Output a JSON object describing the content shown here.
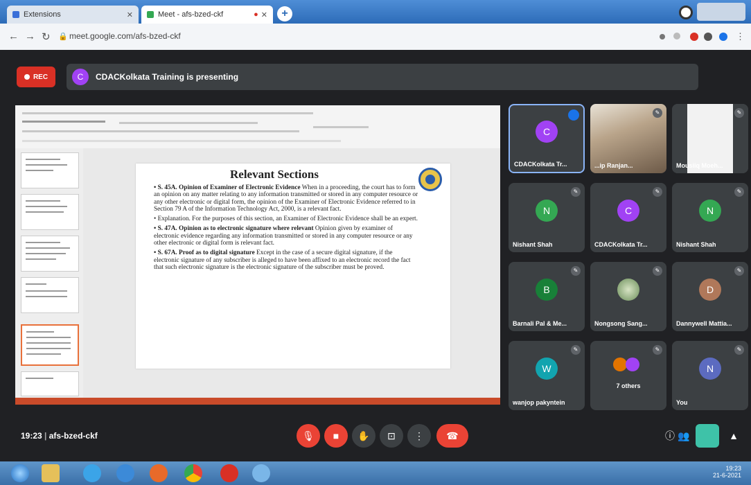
{
  "browser": {
    "tabs": [
      {
        "label": "Extensions"
      },
      {
        "label": "Meet - afs-bzed-ckf"
      }
    ],
    "new_tab": "+",
    "url": "meet.google.com/afs-bzed-ckf"
  },
  "meet": {
    "rec_label": "REC",
    "presenter_avatar": "C",
    "presenting_text": "CDACKolkata Training is presenting",
    "meeting_time": "19:23",
    "meeting_code": "afs-bzed-ckf"
  },
  "slide": {
    "title": "Relevant Sections",
    "bullets": [
      {
        "bold": "• S. 45A. Opinion of Examiner of Electronic Evidence",
        "text": " When in a proceeding, the court has to form an opinion on any matter relating to any information transmitted or stored in any computer resource or any other electronic or digital form, the opinion of the Examiner of Electronic Evidence referred to in Section 79 A of the Information Technology Act, 2000, is a relevant fact."
      },
      {
        "bold": "",
        "text": "• Explanation. For the purposes of this section, an Examiner of Electronic Evidence shall be an expert."
      },
      {
        "bold": "• S. 47A. Opinion as to electronic signature where relevant",
        "text": " Opinion given by examiner of electronic evidence regarding any information transmitted or stored in any computer resource or any other electronic or digital form is relevant fact."
      },
      {
        "bold": "• S. 67A. Proof as to digital signature",
        "text": " Except in the case of a secure digital signature, if the electronic signature of any subscriber is alleged to have been affixed to an electronic record the fact that such electronic signature is the electronic signature of the subscriber must be proved."
      }
    ]
  },
  "participants": [
    {
      "name": "CDACKolkata Tr...",
      "initial": "C",
      "color": "#a142f4",
      "kind": "avatar",
      "active": true
    },
    {
      "name": "...ip Ranjan...",
      "initial": "",
      "color": "",
      "kind": "camera",
      "active": false
    },
    {
      "name": "Mousiiq Moeh...",
      "initial": "",
      "color": "",
      "kind": "camera2",
      "active": false
    },
    {
      "name": "Nishant Shah",
      "initial": "N",
      "color": "#34a853",
      "kind": "avatar",
      "active": false
    },
    {
      "name": "CDACKolkata Tr...",
      "initial": "C",
      "color": "#a142f4",
      "kind": "avatar",
      "active": false
    },
    {
      "name": "Nishant Shah",
      "initial": "N",
      "color": "#34a853",
      "kind": "avatar",
      "active": false
    },
    {
      "name": "Barnali Pal & Me...",
      "initial": "B",
      "color": "#188038",
      "kind": "avatar",
      "active": false
    },
    {
      "name": "Nongsong Sang...",
      "initial": "",
      "color": "#8c9ab0",
      "kind": "photo",
      "active": false
    },
    {
      "name": "Dannywell Mattia...",
      "initial": "D",
      "color": "#b0785a",
      "kind": "avatar",
      "active": false
    },
    {
      "name": "wanjop pakyntein",
      "initial": "W",
      "color": "#12a4af",
      "kind": "avatar",
      "active": false
    },
    {
      "name": "7 others",
      "initial": "",
      "color": "",
      "kind": "others",
      "active": false
    },
    {
      "name": "You",
      "initial": "N",
      "color": "#5c6bc0",
      "kind": "avatar",
      "active": false
    }
  ],
  "controls": {
    "mic": "mic-off-icon",
    "camera": "camera-off-icon",
    "raise_hand": "hand-icon",
    "present": "present-icon",
    "more": "more-icon",
    "leave": "hangup-icon"
  },
  "colors": {
    "red": "#ea4335",
    "meet_bg": "#202124",
    "tile_bg": "#3c4043",
    "accent": "#8ab4f8"
  },
  "taskbar": {
    "time": "19:23",
    "date": "21-6-2021"
  }
}
